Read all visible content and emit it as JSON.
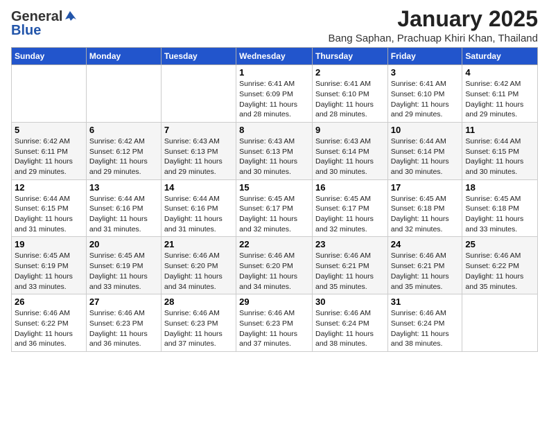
{
  "logo": {
    "general": "General",
    "blue": "Blue"
  },
  "title": "January 2025",
  "location": "Bang Saphan, Prachuap Khiri Khan, Thailand",
  "weekdays": [
    "Sunday",
    "Monday",
    "Tuesday",
    "Wednesday",
    "Thursday",
    "Friday",
    "Saturday"
  ],
  "weeks": [
    [
      {
        "day": "",
        "info": ""
      },
      {
        "day": "",
        "info": ""
      },
      {
        "day": "",
        "info": ""
      },
      {
        "day": "1",
        "info": "Sunrise: 6:41 AM\nSunset: 6:09 PM\nDaylight: 11 hours and 28 minutes."
      },
      {
        "day": "2",
        "info": "Sunrise: 6:41 AM\nSunset: 6:10 PM\nDaylight: 11 hours and 28 minutes."
      },
      {
        "day": "3",
        "info": "Sunrise: 6:41 AM\nSunset: 6:10 PM\nDaylight: 11 hours and 29 minutes."
      },
      {
        "day": "4",
        "info": "Sunrise: 6:42 AM\nSunset: 6:11 PM\nDaylight: 11 hours and 29 minutes."
      }
    ],
    [
      {
        "day": "5",
        "info": "Sunrise: 6:42 AM\nSunset: 6:11 PM\nDaylight: 11 hours and 29 minutes."
      },
      {
        "day": "6",
        "info": "Sunrise: 6:42 AM\nSunset: 6:12 PM\nDaylight: 11 hours and 29 minutes."
      },
      {
        "day": "7",
        "info": "Sunrise: 6:43 AM\nSunset: 6:13 PM\nDaylight: 11 hours and 29 minutes."
      },
      {
        "day": "8",
        "info": "Sunrise: 6:43 AM\nSunset: 6:13 PM\nDaylight: 11 hours and 30 minutes."
      },
      {
        "day": "9",
        "info": "Sunrise: 6:43 AM\nSunset: 6:14 PM\nDaylight: 11 hours and 30 minutes."
      },
      {
        "day": "10",
        "info": "Sunrise: 6:44 AM\nSunset: 6:14 PM\nDaylight: 11 hours and 30 minutes."
      },
      {
        "day": "11",
        "info": "Sunrise: 6:44 AM\nSunset: 6:15 PM\nDaylight: 11 hours and 30 minutes."
      }
    ],
    [
      {
        "day": "12",
        "info": "Sunrise: 6:44 AM\nSunset: 6:15 PM\nDaylight: 11 hours and 31 minutes."
      },
      {
        "day": "13",
        "info": "Sunrise: 6:44 AM\nSunset: 6:16 PM\nDaylight: 11 hours and 31 minutes."
      },
      {
        "day": "14",
        "info": "Sunrise: 6:44 AM\nSunset: 6:16 PM\nDaylight: 11 hours and 31 minutes."
      },
      {
        "day": "15",
        "info": "Sunrise: 6:45 AM\nSunset: 6:17 PM\nDaylight: 11 hours and 32 minutes."
      },
      {
        "day": "16",
        "info": "Sunrise: 6:45 AM\nSunset: 6:17 PM\nDaylight: 11 hours and 32 minutes."
      },
      {
        "day": "17",
        "info": "Sunrise: 6:45 AM\nSunset: 6:18 PM\nDaylight: 11 hours and 32 minutes."
      },
      {
        "day": "18",
        "info": "Sunrise: 6:45 AM\nSunset: 6:18 PM\nDaylight: 11 hours and 33 minutes."
      }
    ],
    [
      {
        "day": "19",
        "info": "Sunrise: 6:45 AM\nSunset: 6:19 PM\nDaylight: 11 hours and 33 minutes."
      },
      {
        "day": "20",
        "info": "Sunrise: 6:45 AM\nSunset: 6:19 PM\nDaylight: 11 hours and 33 minutes."
      },
      {
        "day": "21",
        "info": "Sunrise: 6:46 AM\nSunset: 6:20 PM\nDaylight: 11 hours and 34 minutes."
      },
      {
        "day": "22",
        "info": "Sunrise: 6:46 AM\nSunset: 6:20 PM\nDaylight: 11 hours and 34 minutes."
      },
      {
        "day": "23",
        "info": "Sunrise: 6:46 AM\nSunset: 6:21 PM\nDaylight: 11 hours and 35 minutes."
      },
      {
        "day": "24",
        "info": "Sunrise: 6:46 AM\nSunset: 6:21 PM\nDaylight: 11 hours and 35 minutes."
      },
      {
        "day": "25",
        "info": "Sunrise: 6:46 AM\nSunset: 6:22 PM\nDaylight: 11 hours and 35 minutes."
      }
    ],
    [
      {
        "day": "26",
        "info": "Sunrise: 6:46 AM\nSunset: 6:22 PM\nDaylight: 11 hours and 36 minutes."
      },
      {
        "day": "27",
        "info": "Sunrise: 6:46 AM\nSunset: 6:23 PM\nDaylight: 11 hours and 36 minutes."
      },
      {
        "day": "28",
        "info": "Sunrise: 6:46 AM\nSunset: 6:23 PM\nDaylight: 11 hours and 37 minutes."
      },
      {
        "day": "29",
        "info": "Sunrise: 6:46 AM\nSunset: 6:23 PM\nDaylight: 11 hours and 37 minutes."
      },
      {
        "day": "30",
        "info": "Sunrise: 6:46 AM\nSunset: 6:24 PM\nDaylight: 11 hours and 38 minutes."
      },
      {
        "day": "31",
        "info": "Sunrise: 6:46 AM\nSunset: 6:24 PM\nDaylight: 11 hours and 38 minutes."
      },
      {
        "day": "",
        "info": ""
      }
    ]
  ]
}
